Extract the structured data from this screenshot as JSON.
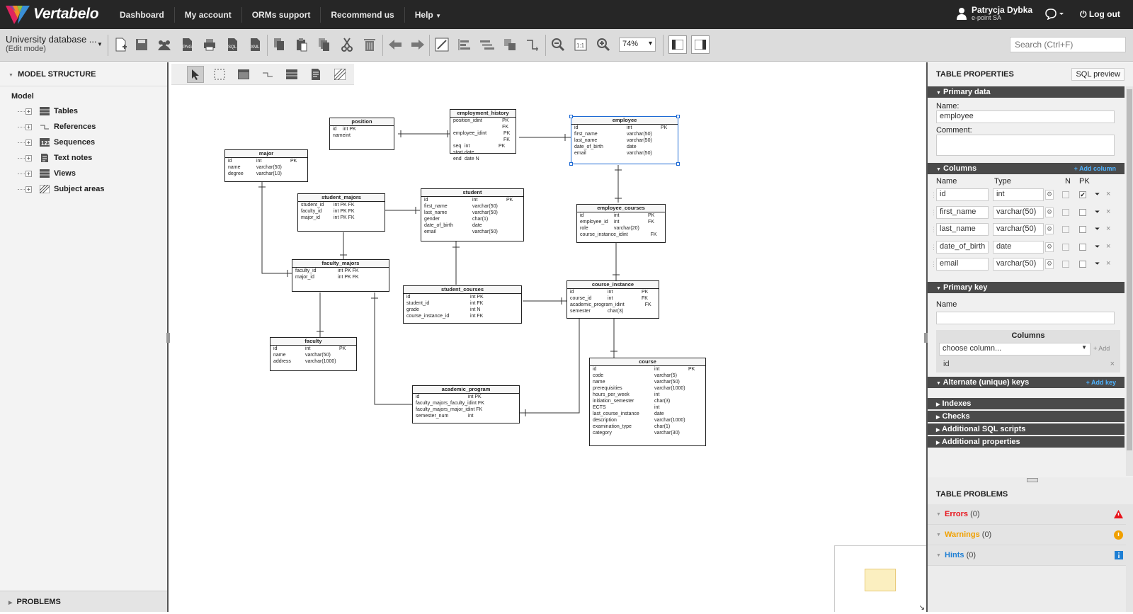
{
  "app": {
    "name": "Vertabelo",
    "colors": {
      "topbar": "#262626",
      "accent": "#1e6ad4",
      "link": "#4fb3ff"
    }
  },
  "nav": {
    "items": [
      "Dashboard",
      "My account",
      "ORMs support",
      "Recommend us",
      "Help"
    ]
  },
  "user": {
    "name": "Patrycja Dybka",
    "company": "e-point SA",
    "logout": "Log out"
  },
  "toolbar": {
    "title": "University database ...",
    "mode": "(Edit mode)",
    "zoom": "74%",
    "search_placeholder": "Search (Ctrl+F)"
  },
  "left": {
    "header": "MODEL STRUCTURE",
    "root": "Model",
    "items": [
      "Tables",
      "References",
      "Sequences",
      "Text notes",
      "Views",
      "Subject areas"
    ],
    "problems": "PROBLEMS"
  },
  "entities": [
    {
      "name": "position",
      "rows": [
        [
          "id",
          "int PK",
          ""
        ],
        [
          "name",
          "int",
          ""
        ]
      ]
    },
    {
      "name": "employment_history",
      "rows": [
        [
          "position_id",
          "int",
          "PK FK"
        ],
        [
          "employee_id",
          "int",
          "PK FK"
        ],
        [
          "seq",
          "int",
          "PK"
        ],
        [
          "start",
          "date",
          ""
        ],
        [
          "end",
          "date N",
          ""
        ]
      ]
    },
    {
      "name": "employee",
      "rows": [
        [
          "id",
          "int",
          "PK"
        ],
        [
          "first_name",
          "varchar(50)",
          ""
        ],
        [
          "last_name",
          "varchar(50)",
          ""
        ],
        [
          "date_of_birth",
          "date",
          ""
        ],
        [
          "email",
          "varchar(50)",
          ""
        ]
      ]
    },
    {
      "name": "major",
      "rows": [
        [
          "id",
          "int",
          "PK"
        ],
        [
          "name",
          "varchar(50)",
          ""
        ],
        [
          "degree",
          "varchar(10)",
          ""
        ]
      ]
    },
    {
      "name": "student_majors",
      "rows": [
        [
          "student_id",
          "int PK FK",
          ""
        ],
        [
          "faculty_id",
          "int PK FK",
          ""
        ],
        [
          "major_id",
          "int PK FK",
          ""
        ]
      ]
    },
    {
      "name": "student",
      "rows": [
        [
          "id",
          "int",
          "PK"
        ],
        [
          "first_name",
          "varchar(50)",
          ""
        ],
        [
          "last_name",
          "varchar(50)",
          ""
        ],
        [
          "gender",
          "char(1)",
          ""
        ],
        [
          "date_of_birth",
          "date",
          ""
        ],
        [
          "email",
          "varchar(50)",
          ""
        ]
      ]
    },
    {
      "name": "employee_courses",
      "rows": [
        [
          "id",
          "int",
          "PK"
        ],
        [
          "employee_id",
          "int",
          "FK"
        ],
        [
          "role",
          "varchar(20)",
          ""
        ],
        [
          "course_instance_id",
          "int",
          "FK"
        ]
      ]
    },
    {
      "name": "faculty_majors",
      "rows": [
        [
          "faculty_id",
          "int PK FK",
          ""
        ],
        [
          "major_id",
          "int PK FK",
          ""
        ]
      ]
    },
    {
      "name": "student_courses",
      "rows": [
        [
          "id",
          "int PK",
          ""
        ],
        [
          "student_id",
          "int FK",
          ""
        ],
        [
          "grade",
          "int N",
          ""
        ],
        [
          "course_instance_id",
          "int FK",
          ""
        ]
      ]
    },
    {
      "name": "course_instance",
      "rows": [
        [
          "id",
          "int",
          "PK"
        ],
        [
          "course_id",
          "int",
          "FK"
        ],
        [
          "academic_program_id",
          "int",
          "FK"
        ],
        [
          "semester",
          "char(3)",
          ""
        ]
      ]
    },
    {
      "name": "faculty",
      "rows": [
        [
          "id",
          "int",
          "PK"
        ],
        [
          "name",
          "varchar(50)",
          ""
        ],
        [
          "address",
          "varchar(1000)",
          ""
        ]
      ]
    },
    {
      "name": "course",
      "rows": [
        [
          "id",
          "int",
          "PK"
        ],
        [
          "code",
          "varchar(5)",
          ""
        ],
        [
          "name",
          "varchar(50)",
          ""
        ],
        [
          "prerequisities",
          "varchar(1000)",
          ""
        ],
        [
          "hours_per_week",
          "int",
          ""
        ],
        [
          "initiation_semester",
          "char(3)",
          ""
        ],
        [
          "ECTS",
          "int",
          ""
        ],
        [
          "last_course_instance",
          "date",
          ""
        ],
        [
          "description",
          "varchar(1000)",
          ""
        ],
        [
          "examination_type",
          "char(1)",
          ""
        ],
        [
          "category",
          "varchar(30)",
          ""
        ]
      ]
    },
    {
      "name": "academic_program",
      "rows": [
        [
          "id",
          "int PK",
          ""
        ],
        [
          "faculty_majors_faculty_id",
          "int FK",
          ""
        ],
        [
          "faculty_majors_major_id",
          "int FK",
          ""
        ],
        [
          "semester_num",
          "int",
          ""
        ]
      ]
    }
  ],
  "right": {
    "header": "TABLE PROPERTIES",
    "sql_preview": "SQL preview",
    "primary_data": "Primary data",
    "name_label": "Name:",
    "name_value": "employee",
    "comment_label": "Comment:",
    "columns": "Columns",
    "add_column": "+ Add column",
    "col_headers": [
      "Name",
      "Type",
      "N",
      "PK"
    ],
    "cols": [
      {
        "name": "id",
        "type": "int",
        "pk": true
      },
      {
        "name": "first_name",
        "type": "varchar(50)",
        "pk": false
      },
      {
        "name": "last_name",
        "type": "varchar(50)",
        "pk": false
      },
      {
        "name": "date_of_birth",
        "type": "date",
        "pk": false
      },
      {
        "name": "email",
        "type": "varchar(50)",
        "pk": false
      }
    ],
    "primary_key": "Primary key",
    "pk_name_label": "Name",
    "pk_columns": "Columns",
    "choose_column": "choose column...",
    "add": "+ Add",
    "pk_col": "id",
    "alt_keys": "Alternate (unique) keys",
    "add_key": "+ Add key",
    "indexes": "Indexes",
    "checks": "Checks",
    "additional_sql": "Additional SQL scripts",
    "additional_props": "Additional properties"
  },
  "problems": {
    "header": "TABLE PROBLEMS",
    "errors": "Errors",
    "errors_n": "(0)",
    "warnings": "Warnings",
    "warnings_n": "(0)",
    "hints": "Hints",
    "hints_n": "(0)"
  }
}
